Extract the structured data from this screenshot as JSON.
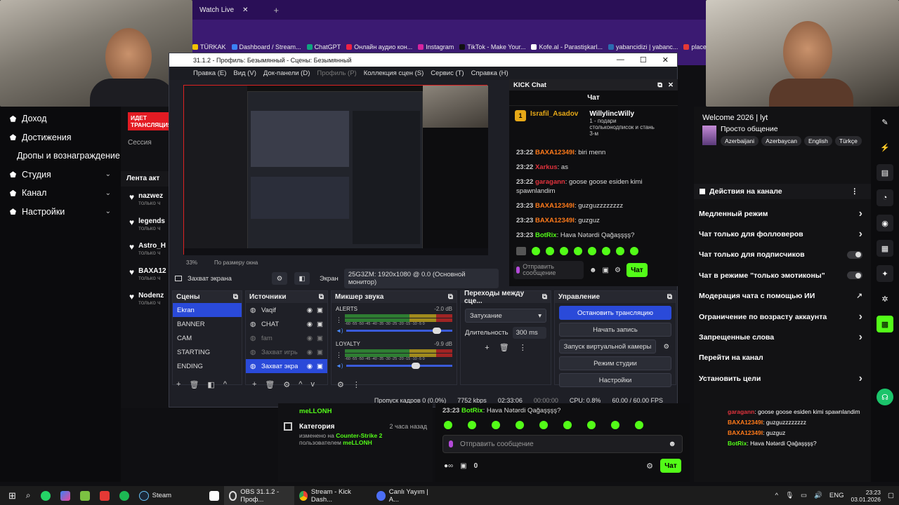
{
  "browser": {
    "tab_title": "Watch Live",
    "bookmarks": [
      "TÜRKAK",
      "Dashboard / Stream...",
      "ChatGPT",
      "Онлайн аудио кон...",
      "Instagram",
      "TikTok - Make Your...",
      "Kofe.al - Parastişkarl...",
      "yabancidizi | yabanc...",
      "place"
    ]
  },
  "kick_left": {
    "nav": [
      "Доход",
      "Достижения",
      "Дропы и вознаграждение",
      "Студия",
      "Канал",
      "Настройки"
    ],
    "live_badge": "ИДЕТ ТРАНСЛЯЦИЯ",
    "session": "Сессия",
    "feed_title": "Лента акт",
    "feed_items": [
      {
        "name": "nazwez",
        "sub": "только ч"
      },
      {
        "name": "legends",
        "sub": "только ч"
      },
      {
        "name": "Astro_H",
        "sub": "только ч"
      },
      {
        "name": "BAXA12",
        "sub": "только ч"
      },
      {
        "name": "Nodenz",
        "sub": "только ч"
      }
    ]
  },
  "obs": {
    "title": "31.1.2 - Профиль: Безымянный - Сцены: Безымянный",
    "menu": [
      "Правка (E)",
      "Вид (V)",
      "Док-панели (D)",
      "Профиль (P)",
      "Коллекция сцен (S)",
      "Сервис (T)",
      "Справка (H)"
    ],
    "zoom": "33%",
    "fit": "По размеру окна",
    "source_name": "Захват экрана",
    "screen_label": "Экран",
    "screen_value": "25G3ZM: 1920x1080 @ 0.0 (Основной монитор)",
    "scenes_title": "Сцены",
    "scenes": [
      "Ekran",
      "BANNER",
      "CAM",
      "STARTING",
      "ENDING"
    ],
    "sources_title": "Источники",
    "sources": [
      "Vaqif",
      "CHAT",
      "fam",
      "Захват игры",
      "Захват экра"
    ],
    "mixer_title": "Микшер звука",
    "mixer": [
      {
        "name": "ALERTS",
        "db": "-2.0 dB"
      },
      {
        "name": "LOYALTY",
        "db": "-9.9 dB"
      }
    ],
    "mixer_scale": "-60 -55 -50 -45 -40 -35 -30 -25 -20 -15 -10 -5 0",
    "transitions_title": "Переходы между сце...",
    "transition": "Затухание",
    "duration_label": "Длительность",
    "duration_value": "300 ms",
    "controls_title": "Управление",
    "controls": [
      "Остановить трансляцию",
      "Начать запись",
      "Запуск виртуальной камеры",
      "Режим студии",
      "Настройки"
    ],
    "status": {
      "dropped": "Пропуск кадров 0 (0.0%)",
      "kbps": "7752 kbps",
      "time": "02:33:06",
      "rec": "00:00:00",
      "cpu": "CPU: 0.8%",
      "fps": "60.00 / 60.00 FPS"
    }
  },
  "kick_chat": {
    "window_title": "KICK Chat",
    "header": "Чат",
    "pinned_user": "Israfil_Asadov",
    "pinned_count": "1",
    "gift_user": "WillylincWilly",
    "gift_text": "1 - подари стольконодписок и стань 3-м",
    "messages": [
      {
        "time": "23:22",
        "user": "BAXA12349I",
        "cls": "u1",
        "text": "biri menn"
      },
      {
        "time": "23:22",
        "user": "Xarkus",
        "cls": "u2",
        "text": "as"
      },
      {
        "time": "23:22",
        "user": "garagann",
        "cls": "u2",
        "text": "goose goose esiden kimi spawnlandim"
      },
      {
        "time": "23:23",
        "user": "BAXA12349I",
        "cls": "u1",
        "text": "guzguzzzzzzzz"
      },
      {
        "time": "23:23",
        "user": "BAXA12349I",
        "cls": "u1",
        "text": "guzguz"
      },
      {
        "time": "23:23",
        "user": "BotRix",
        "cls": "u3",
        "text": "Hava Nətərdi Qağaşşşş?"
      }
    ],
    "input_placeholder": "Отправить сообщение",
    "send": "Чат"
  },
  "stream_info": {
    "title": "Welcome 2026 | lyt",
    "category": "Просто общение",
    "tags": [
      "Azerbaijani",
      "Azerbaycan",
      "English",
      "Türkçe"
    ]
  },
  "channel_actions": {
    "title": "Действия на канале",
    "items": [
      {
        "label": "Медленный режим",
        "type": "arrow"
      },
      {
        "label": "Чат только для фолловеров",
        "type": "arrow"
      },
      {
        "label": "Чат только для подписчиков",
        "type": "toggle"
      },
      {
        "label": "Чат в режиме \"только эмотиконы\"",
        "type": "toggle"
      },
      {
        "label": "Модерация чата с помощью ИИ",
        "type": "ext"
      },
      {
        "label": "Ограничение по возрасту аккаунта",
        "type": "arrow"
      },
      {
        "label": "Запрещенные слова",
        "type": "arrow"
      },
      {
        "label": "Перейти на канал",
        "type": "none"
      },
      {
        "label": "Установить цели",
        "type": "arrow"
      }
    ]
  },
  "overlay_chat": [
    {
      "user": "garagann",
      "cls": "u2",
      "text": "goose goose esiden kimi spawnlandim"
    },
    {
      "user": "BAXA12349I",
      "cls": "u1",
      "text": "guzguzzzzzzzz"
    },
    {
      "user": "BAXA12349I",
      "cls": "u1",
      "text": "guzguz"
    },
    {
      "user": "BotRix",
      "cls": "u3",
      "text": "Hava Nətərdi Qağaşşşş?"
    }
  ],
  "bottom": {
    "user": "meLLONH",
    "category_title": "Категория",
    "category_time": "2 часа назад",
    "category_change": "изменено на",
    "category_game": "Counter-Strike 2",
    "category_by": "пользователем",
    "chat_time": "23:23",
    "chat_user": "BotRix",
    "chat_text": "Hava Nətərdi Qağaşşşş?",
    "input_placeholder": "Отправить сообщение",
    "count": "0",
    "send": "Чат"
  },
  "taskbar": {
    "apps": [
      "Steam",
      "OBS 31.1.2 - Проф...",
      "Stream - Kick Dash...",
      "Canlı Yayım | A..."
    ],
    "lang": "ENG",
    "time": "23:23",
    "date": "03.01.2026"
  }
}
